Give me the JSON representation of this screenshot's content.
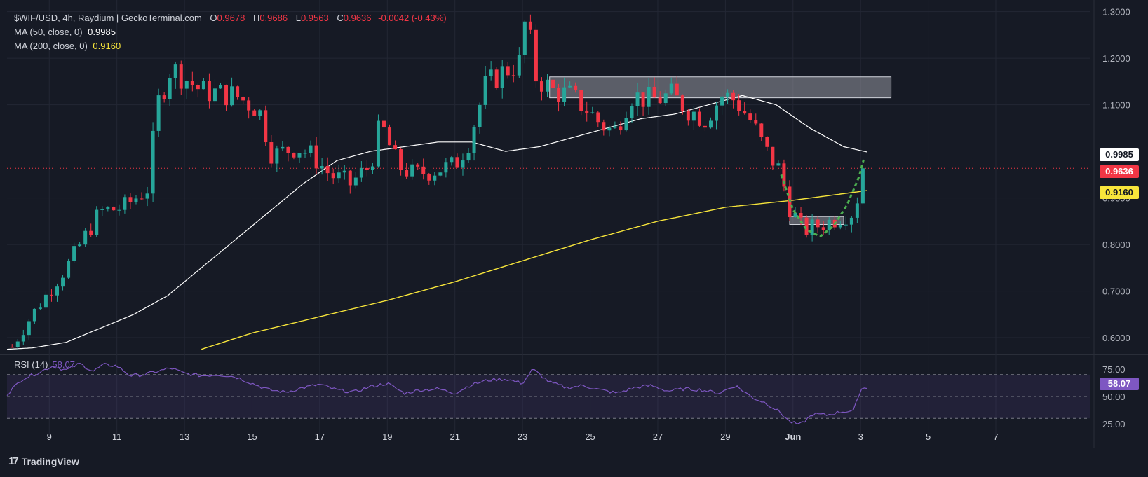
{
  "header": {
    "symbol_line": "$WIF/USD, 4h, Raydium | GeckoTerminal.com",
    "o_label": "O",
    "o_value": "0.9678",
    "h_label": "H",
    "h_value": "0.9686",
    "l_label": "L",
    "l_value": "0.9563",
    "c_label": "C",
    "c_value": "0.9636",
    "change": "-0.0042 (-0.43%)"
  },
  "indicators": {
    "ma50_label": "MA (50, close, 0)",
    "ma50_value": "0.9985",
    "ma200_label": "MA (200, close, 0)",
    "ma200_value": "0.9160",
    "rsi_label": "RSI (14)",
    "rsi_value": "58.07"
  },
  "price_tags": {
    "ma50": "0.9985",
    "last": "0.9636",
    "ma200": "0.9160",
    "rsi": "58.07"
  },
  "branding": {
    "logo_text": "TradingView",
    "logo_mark": "17"
  },
  "colors": {
    "background": "#161a25",
    "grid": "#232734",
    "up": "#26a69a",
    "down": "#f23645",
    "ma50": "#ffffff",
    "ma200": "#f7e53b",
    "rsi": "#7e57c2",
    "pattern": "#4caf50",
    "zone": "#9598a1"
  },
  "chart_data": [
    {
      "type": "candlestick",
      "title": "$WIF/USD, 4h, Raydium | GeckoTerminal.com",
      "ylim": [
        0.57,
        1.31
      ],
      "y_ticks": [
        "1.3000",
        "1.2000",
        "1.1000",
        "0.9000",
        "0.8000",
        "0.7000",
        "0.6000"
      ],
      "x_tick_labels": [
        "9",
        "11",
        "13",
        "15",
        "17",
        "19",
        "21",
        "23",
        "25",
        "27",
        "29",
        "Jun",
        "3",
        "5",
        "7"
      ],
      "x_tick_days": [
        9,
        11,
        13,
        15,
        17,
        19,
        21,
        23,
        25,
        27,
        29,
        31,
        33,
        35,
        37
      ],
      "x_range_days": [
        7.75,
        39.8
      ],
      "last_candle_day": 33.2,
      "grid": true,
      "price_path_days": [
        7.9,
        8.5,
        9.5,
        10.5,
        11.2,
        11.9,
        12.2,
        12.6,
        13.5,
        14.5,
        15.2,
        15.6,
        16.3,
        16.8,
        17.3,
        17.9,
        18.5,
        18.8,
        19.3,
        19.8,
        20.4,
        21.0,
        21.4,
        21.9,
        22.4,
        22.9,
        23.1,
        23.4,
        23.9,
        24.4,
        24.9,
        25.3,
        25.7,
        26.2,
        26.8,
        27.4,
        27.9,
        28.4,
        28.9,
        29.3,
        29.8,
        30.2,
        30.6,
        30.9,
        31.3,
        31.7,
        32.1,
        32.4,
        32.8,
        33.0,
        33.2
      ],
      "price_path_values": [
        0.58,
        0.65,
        0.75,
        0.87,
        0.88,
        0.92,
        1.1,
        1.18,
        1.13,
        1.12,
        1.09,
        0.99,
        1.01,
        0.99,
        0.95,
        0.93,
        0.97,
        1.06,
        0.97,
        0.95,
        0.96,
        0.97,
        1.02,
        1.14,
        1.17,
        1.19,
        1.29,
        1.16,
        1.13,
        1.12,
        1.09,
        1.06,
        1.04,
        1.12,
        1.11,
        1.12,
        1.09,
        1.07,
        1.12,
        1.11,
        1.06,
        1.0,
        0.96,
        0.88,
        0.83,
        0.84,
        0.85,
        0.86,
        0.87,
        0.93,
        0.9636
      ],
      "ma50_days": [
        7.75,
        8.5,
        9.5,
        10.5,
        11.5,
        12.5,
        13.5,
        14.5,
        15.5,
        16.5,
        17.5,
        18.5,
        19.5,
        20.5,
        21.5,
        22.5,
        23.5,
        24.5,
        25.5,
        26.5,
        27.5,
        28.5,
        29.5,
        30.5,
        31.5,
        32.5,
        33.2
      ],
      "ma50_values": [
        0.575,
        0.578,
        0.59,
        0.62,
        0.65,
        0.69,
        0.75,
        0.81,
        0.87,
        0.93,
        0.98,
        1.0,
        1.01,
        1.02,
        1.02,
        1.0,
        1.01,
        1.03,
        1.05,
        1.07,
        1.08,
        1.1,
        1.12,
        1.1,
        1.05,
        1.01,
        0.9985
      ],
      "ma200_days": [
        13.5,
        15,
        17,
        19,
        21,
        23,
        25,
        27,
        29,
        31,
        33.2
      ],
      "ma200_values": [
        0.575,
        0.61,
        0.645,
        0.68,
        0.72,
        0.765,
        0.81,
        0.85,
        0.88,
        0.895,
        0.916
      ],
      "resistance_zone": {
        "day_start": 23.8,
        "day_end": 33.9,
        "low": 1.115,
        "high": 1.16
      },
      "support_zone": {
        "day_start": 30.9,
        "day_end": 32.5,
        "low": 0.843,
        "high": 0.86
      },
      "cup_pattern_days": [
        30.65,
        31.0,
        31.4,
        31.8,
        32.2,
        32.6,
        32.95,
        33.1
      ],
      "cup_pattern_values": [
        0.95,
        0.875,
        0.832,
        0.817,
        0.84,
        0.885,
        0.945,
        0.985
      ],
      "last_price": 0.9636
    },
    {
      "type": "line",
      "title": "RSI (14)",
      "ylim": [
        18,
        82
      ],
      "y_ticks": [
        "75.00",
        "50.00",
        "25.00"
      ],
      "levels": [
        70,
        50,
        30
      ],
      "days": [
        7.75,
        8.2,
        8.7,
        9.1,
        9.5,
        9.9,
        10.3,
        10.6,
        11.0,
        11.4,
        11.8,
        12.2,
        12.6,
        13.0,
        13.5,
        14.0,
        14.5,
        15.0,
        15.5,
        16.0,
        16.5,
        17.0,
        17.5,
        18.0,
        18.5,
        19.0,
        19.5,
        20.0,
        20.5,
        21.0,
        21.5,
        22.0,
        22.5,
        23.0,
        23.3,
        23.8,
        24.3,
        24.8,
        25.3,
        25.8,
        26.3,
        26.8,
        27.3,
        27.8,
        28.3,
        28.8,
        29.3,
        29.8,
        30.2,
        30.6,
        30.9,
        31.2,
        31.6,
        32.0,
        32.4,
        32.8,
        33.0,
        33.2
      ],
      "values": [
        52,
        66,
        72,
        78,
        74,
        80,
        73,
        79,
        78,
        69,
        70,
        73,
        76,
        71,
        69,
        70,
        68,
        62,
        56,
        54,
        58,
        61,
        56,
        54,
        59,
        62,
        53,
        56,
        57,
        53,
        61,
        65,
        66,
        62,
        75,
        63,
        58,
        60,
        56,
        53,
        58,
        60,
        55,
        57,
        56,
        53,
        60,
        49,
        44,
        36,
        27,
        24,
        34,
        33,
        36,
        37,
        57,
        58.07
      ],
      "last_value": 58.07
    }
  ]
}
